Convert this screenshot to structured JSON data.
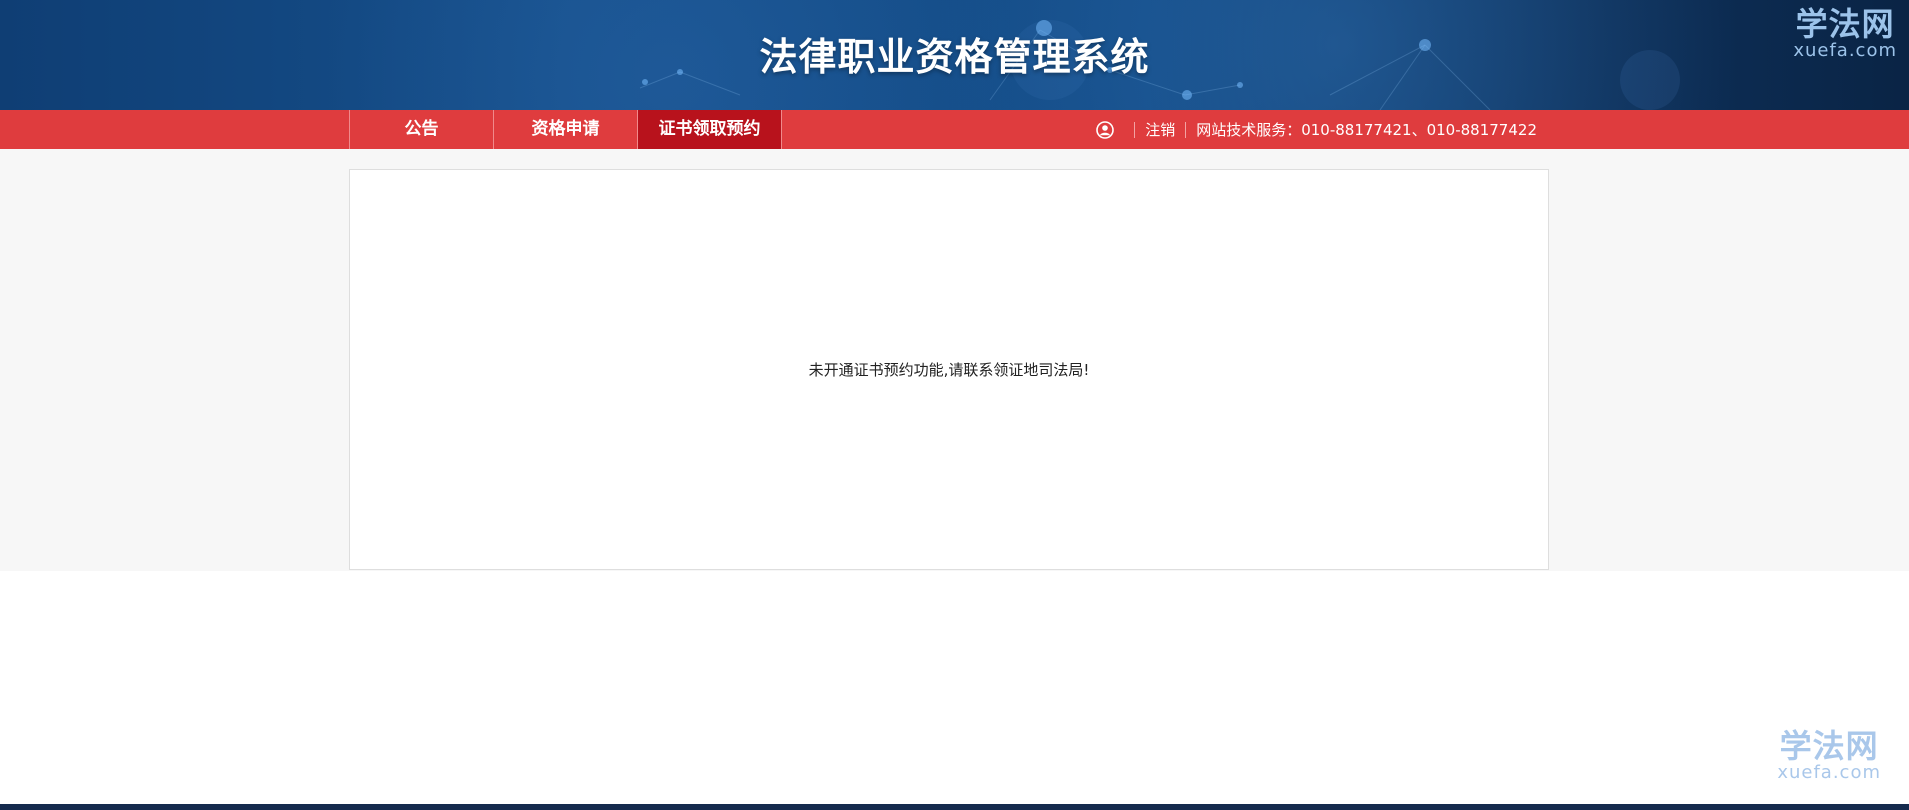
{
  "header": {
    "title": "法律职业资格管理系统"
  },
  "watermark": {
    "cn": "学法网",
    "en": "xuefa.com"
  },
  "nav": {
    "tabs": [
      {
        "label": "公告",
        "active": false
      },
      {
        "label": "资格申请",
        "active": false
      },
      {
        "label": "证书领取预约",
        "active": true
      }
    ],
    "user_icon": "user-circle-icon",
    "logout_label": "注销",
    "service_text": "网站技术服务：010-88177421、010-88177422"
  },
  "main": {
    "message": "未开通证书预约功能,请联系领证地司法局!"
  },
  "colors": {
    "banner": "#134b86",
    "nav_red": "#df3c3e",
    "nav_active": "#b8121c",
    "content_bg": "#f7f7f7",
    "footer_line": "#152a4d"
  }
}
